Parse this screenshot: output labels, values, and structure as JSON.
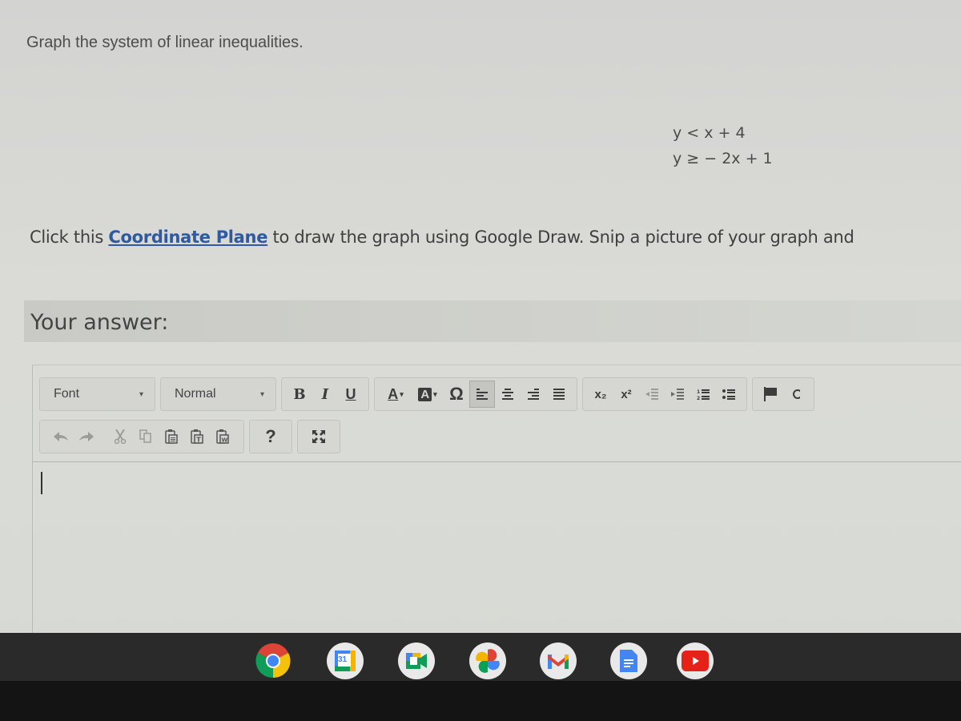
{
  "question": {
    "title": "Graph the system of linear inequalities.",
    "equations": [
      "y < x + 4",
      "y ≥ − 2x + 1"
    ],
    "instruction": {
      "before_link": "Click this ",
      "link_text": "Coordinate Plane",
      "after_link": " to draw the graph using Google Draw.  Snip a picture of your graph and"
    }
  },
  "answer": {
    "label": "Your answer:",
    "value": ""
  },
  "editor_toolbar": {
    "font_select": {
      "value": "Font",
      "arrow": "▾"
    },
    "format_select": {
      "value": "Normal",
      "arrow": "▾"
    },
    "bold": "B",
    "italic": "I",
    "underline": "U",
    "text_color": "A",
    "bg_color": "A",
    "special_char": "Ω",
    "help": "?",
    "subscript": "x₂",
    "superscript": "x²",
    "active_alignment": "left"
  },
  "shelf": {
    "apps": [
      "chrome",
      "calendar",
      "meet",
      "photos",
      "gmail",
      "docs",
      "youtube"
    ],
    "calendar_day": "31"
  },
  "colors": {
    "link": "#2f5aa0",
    "shelf_bg": "#2a2a2a"
  }
}
